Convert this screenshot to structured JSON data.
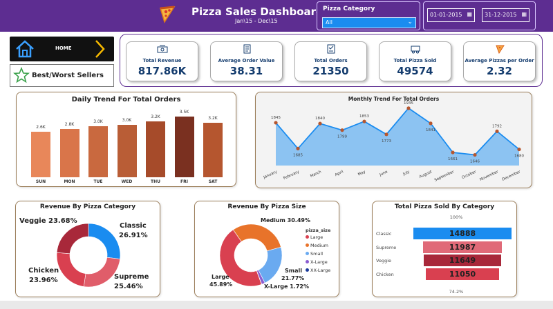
{
  "header": {
    "title": "Pizza Sales Dashboard",
    "subtitle": "Jan\\15 - Dec\\15",
    "category_label": "Pizza Category",
    "category_value": "All",
    "date_from": "01-01-2015",
    "date_to": "31-12-2015",
    "color": "#5d2d91"
  },
  "nav": {
    "home": "HOME",
    "best_worst": "Best/Worst Sellers"
  },
  "kpis": [
    {
      "label": "Total Revenue",
      "value": "817.86K",
      "icon": "money-icon"
    },
    {
      "label": "Average Order Value",
      "value": "38.31",
      "icon": "receipt-icon"
    },
    {
      "label": "Total Orders",
      "value": "21350",
      "icon": "orders-icon"
    },
    {
      "label": "Total Pizza Sold",
      "value": "49574",
      "icon": "delivery-icon"
    },
    {
      "label": "Average Pizzas per Order",
      "value": "2.32",
      "icon": "pizza-slice-icon"
    }
  ],
  "chart_data": [
    {
      "type": "bar",
      "title": "Daily Trend For Total Orders",
      "categories": [
        "SUN",
        "MON",
        "TUE",
        "WED",
        "THU",
        "FRI",
        "SAT"
      ],
      "values": [
        2624,
        2794,
        2973,
        3024,
        3239,
        3538,
        3158
      ],
      "labels": [
        "2.6K",
        "2.8K",
        "3.0K",
        "3.0K",
        "3.2K",
        "3.5K",
        "3.2K"
      ],
      "colors": [
        "#e8875a",
        "#d9754a",
        "#c9693f",
        "#b95d36",
        "#a64b2a",
        "#7a3020",
        "#b5562f"
      ]
    },
    {
      "type": "area",
      "title": "Monthly Trend For Total Orders",
      "categories": [
        "January",
        "February",
        "March",
        "April",
        "May",
        "June",
        "July",
        "August",
        "September",
        "October",
        "November",
        "December"
      ],
      "values": [
        1845,
        1685,
        1840,
        1799,
        1853,
        1773,
        1935,
        1841,
        1661,
        1646,
        1792,
        1680
      ],
      "ylim": [
        1580,
        1960
      ],
      "line_color": "#1a8cf0",
      "fill_color": "#8cc3f2"
    },
    {
      "type": "pie",
      "title": "Revenue By Pizza Category",
      "categories": [
        "Classic",
        "Supreme",
        "Chicken",
        "Veggie"
      ],
      "values": [
        26.91,
        25.46,
        23.96,
        23.68
      ],
      "colors": [
        "#1a8cf0",
        "#e05d6a",
        "#d94050",
        "#a8283a"
      ],
      "labels": {
        "classic_name": "Classic",
        "classic_pct": "26.91%",
        "supreme_name": "Supreme",
        "supreme_pct": "25.46%",
        "chicken_name": "Chicken",
        "chicken_pct": "23.96%",
        "veggie": "Veggie 23.68%"
      }
    },
    {
      "type": "pie",
      "title": "Revenue By Pizza Size",
      "categories": [
        "Large",
        "Medium",
        "Small",
        "X-Large",
        "XX-Large"
      ],
      "values": [
        45.89,
        30.49,
        21.77,
        1.72,
        0.12
      ],
      "colors": [
        "#d94050",
        "#e8732a",
        "#6aaaf0",
        "#8a5cd0",
        "#1a3a9a"
      ],
      "legend_title": "pizza_size",
      "labels": {
        "medium": "Medium 30.49%",
        "large_name": "Large",
        "large_pct": "45.89%",
        "small_name": "Small",
        "small_pct": "21.77%",
        "xlarge": "X-Large 1.72%"
      }
    },
    {
      "type": "bar",
      "title": "Total Pizza Sold By Category",
      "categories": [
        "Classic",
        "Supreme",
        "Veggie",
        "Chicken"
      ],
      "values": [
        14888,
        11987,
        11649,
        11050
      ],
      "colors": [
        "#1a8cf0",
        "#e06a78",
        "#a8283a",
        "#d94050"
      ],
      "top_pct": "100%",
      "bottom_pct": "74.2%"
    }
  ]
}
